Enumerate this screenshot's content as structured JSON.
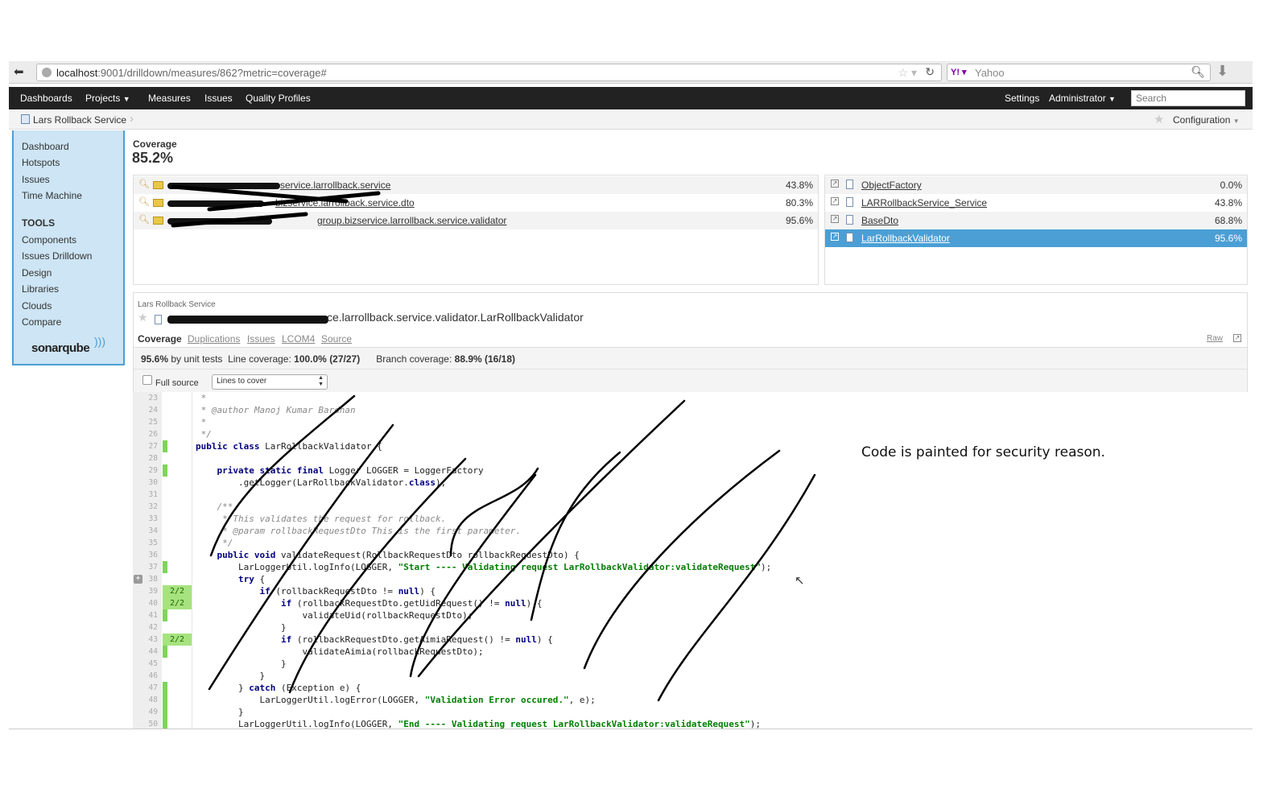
{
  "browser": {
    "url_host": "localhost",
    "url_rest": ":9001/drilldown/measures/862?metric=coverage#",
    "search_engine": "Yahoo"
  },
  "nav": {
    "items": [
      "Dashboards",
      "Projects",
      "Measures",
      "Issues",
      "Quality Profiles"
    ],
    "right": [
      "Settings",
      "Administrator"
    ],
    "search_placeholder": "Search"
  },
  "breadcrumb": {
    "project": "Lars Rollback Service",
    "configuration": "Configuration"
  },
  "sidebar": {
    "items": [
      "Dashboard",
      "Hotspots",
      "Issues",
      "Time Machine"
    ],
    "tools_heading": "TOOLS",
    "tools": [
      "Components",
      "Issues Drilldown",
      "Design",
      "Libraries",
      "Clouds",
      "Compare"
    ],
    "logo": "sonarqube"
  },
  "metric": {
    "label": "Coverage",
    "value": "85.2%"
  },
  "packages": [
    {
      "name": "service.larrollback.service",
      "value": "43.8%"
    },
    {
      "name": "bizservice.larrollback.service.dto",
      "value": "80.3%"
    },
    {
      "name": "group.bizservice.larrollback.service.validator",
      "value": "95.6%"
    }
  ],
  "files": [
    {
      "name": "ObjectFactory",
      "value": "0.0%",
      "selected": false
    },
    {
      "name": "LARRollbackService_Service",
      "value": "43.8%",
      "selected": false
    },
    {
      "name": "BaseDto",
      "value": "68.8%",
      "selected": false
    },
    {
      "name": "LarRollbackValidator",
      "value": "95.6%",
      "selected": true
    }
  ],
  "colors": {
    "selected": "#4b9fd5",
    "covered": "#7fd45b",
    "navbar": "#222222"
  },
  "viewer": {
    "project": "Lars Rollback Service",
    "file_path": "ce.larrollback.service.validator.LarRollbackValidator",
    "tabs": [
      "Coverage",
      "Duplications",
      "Issues",
      "LCOM4",
      "Source"
    ],
    "raw": "Raw",
    "summary": {
      "pct": "95.6%",
      "by": "by unit tests",
      "line_label": "Line coverage:",
      "line_value": "100.0% (27/27)",
      "branch_label": "Branch coverage:",
      "branch_value": "88.9% (16/18)"
    },
    "full_source": "Full source",
    "filter": "Lines to cover"
  },
  "annotation": "Code is painted for security reason.",
  "code": [
    {
      "n": "23",
      "t": " *",
      "cov": ""
    },
    {
      "n": "24",
      "t": " * @author Manoj Kumar Bardhan",
      "cov": ""
    },
    {
      "n": "25",
      "t": " *",
      "cov": ""
    },
    {
      "n": "26",
      "t": " */",
      "cov": ""
    },
    {
      "n": "27",
      "t": "public class LarRollbackValidator {",
      "cov": "hit"
    },
    {
      "n": "28",
      "t": "",
      "cov": ""
    },
    {
      "n": "29",
      "t": "    private static final Logger LOGGER = LoggerFactory",
      "cov": "hit"
    },
    {
      "n": "30",
      "t": "        .getLogger(LarRollbackValidator.class);",
      "cov": ""
    },
    {
      "n": "31",
      "t": "",
      "cov": ""
    },
    {
      "n": "32",
      "t": "    /**",
      "cov": ""
    },
    {
      "n": "33",
      "t": "     * This validates the request for rollback.",
      "cov": ""
    },
    {
      "n": "34",
      "t": "     * @param rollbackRequestDto This is the first parameter.",
      "cov": ""
    },
    {
      "n": "35",
      "t": "     */",
      "cov": ""
    },
    {
      "n": "36",
      "t": "    public void validateRequest(RollbackRequestDto rollbackRequestDto) {",
      "cov": ""
    },
    {
      "n": "37",
      "t": "        LarLoggerUtil.logInfo(LOGGER, \"Start ---- Validating request LarRollbackValidator:validateRequest\");",
      "cov": "hit"
    },
    {
      "n": "38",
      "t": "        try {",
      "cov": ""
    },
    {
      "n": "39",
      "t": "            if (rollbackRequestDto != null) {",
      "cov": "br",
      "b": "2/2"
    },
    {
      "n": "40",
      "t": "                if (rollbackRequestDto.getUidRequest() != null) {",
      "cov": "br",
      "b": "2/2"
    },
    {
      "n": "41",
      "t": "                    validateUid(rollbackRequestDto);",
      "cov": "hit"
    },
    {
      "n": "42",
      "t": "                }",
      "cov": ""
    },
    {
      "n": "43",
      "t": "                if (rollbackRequestDto.getAimiaRequest() != null) {",
      "cov": "br",
      "b": "2/2"
    },
    {
      "n": "44",
      "t": "                    validateAimia(rollbackRequestDto);",
      "cov": "hit"
    },
    {
      "n": "45",
      "t": "                }",
      "cov": ""
    },
    {
      "n": "46",
      "t": "            }",
      "cov": ""
    },
    {
      "n": "47",
      "t": "        } catch (Exception e) {",
      "cov": "hit"
    },
    {
      "n": "48",
      "t": "            LarLoggerUtil.logError(LOGGER, \"Validation Error occured.\", e);",
      "cov": "hit"
    },
    {
      "n": "49",
      "t": "        }",
      "cov": "hit"
    },
    {
      "n": "50",
      "t": "        LarLoggerUtil.logInfo(LOGGER, \"End ---- Validating request LarRollbackValidator:validateRequest\");",
      "cov": "hit"
    }
  ]
}
